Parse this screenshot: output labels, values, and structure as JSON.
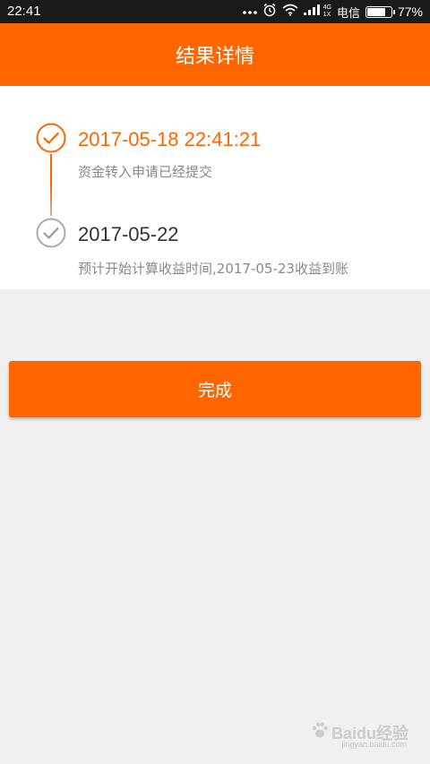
{
  "status_bar": {
    "time": "22:41",
    "net_type_top": "4G",
    "net_type_bottom": "1X",
    "carrier": "电信",
    "battery": "77%",
    "battery_level": 0.77,
    "icons": [
      "more-dots-icon",
      "alarm-icon",
      "wifi-icon",
      "signal-icon",
      "battery-icon"
    ]
  },
  "header": {
    "title": "结果详情"
  },
  "timeline": {
    "items": [
      {
        "date": "2017-05-18 22:41:21",
        "description": "资金转入申请已经提交",
        "status": "done"
      },
      {
        "date": "2017-05-22",
        "description": "预计开始计算收益时间,2017-05-23收益到账",
        "status": "pending"
      }
    ]
  },
  "actions": {
    "done_label": "完成"
  },
  "watermark": {
    "text": "Baidu经验",
    "sub": "jingyan.baidu.com"
  },
  "colors": {
    "accent": "#ff6600",
    "status_bar_bg": "#1a1a1a",
    "page_bg": "#f0f0f0",
    "pending_gray": "#bbbbbb"
  }
}
